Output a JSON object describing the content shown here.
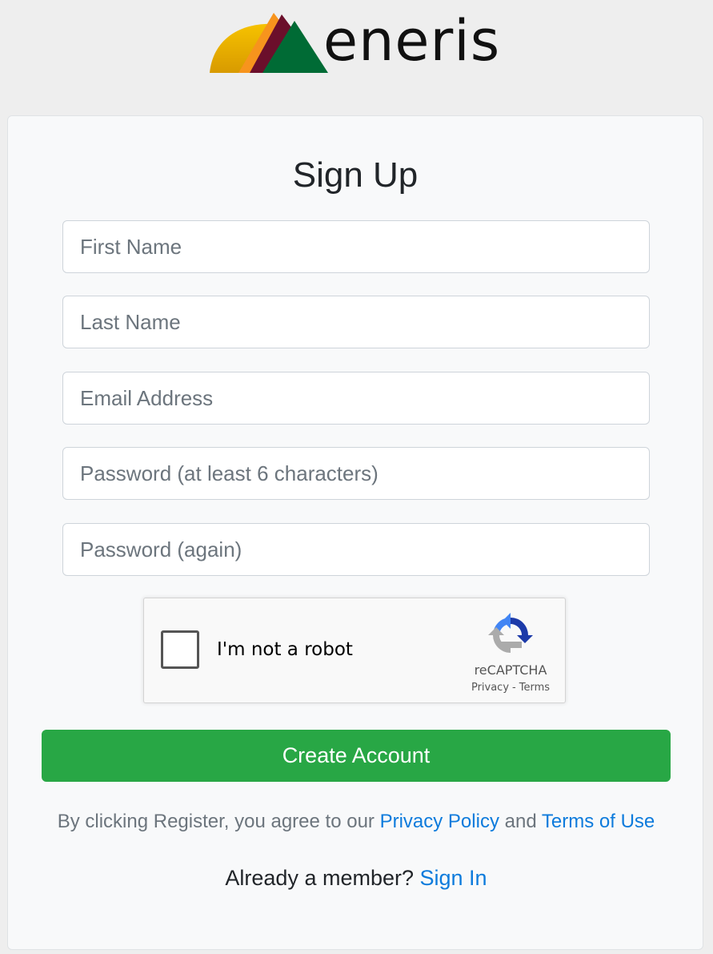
{
  "brand": {
    "logo_text": "eneris",
    "logo_icon": "mountain-sun-logo",
    "colors": {
      "sun": "#f2b705",
      "orange": "#f7941d",
      "maroon": "#6b0f2b",
      "green": "#006b35"
    }
  },
  "form": {
    "title": "Sign Up",
    "fields": {
      "first_name": {
        "placeholder": "First Name",
        "value": ""
      },
      "last_name": {
        "placeholder": "Last Name",
        "value": ""
      },
      "email": {
        "placeholder": "Email Address",
        "value": ""
      },
      "password": {
        "placeholder": "Password (at least 6 characters)",
        "value": ""
      },
      "password_again": {
        "placeholder": "Password (again)",
        "value": ""
      }
    },
    "captcha": {
      "label": "I'm not a robot",
      "checked": false,
      "brand": "reCAPTCHA",
      "privacy": "Privacy",
      "separator": "-",
      "terms": "Terms",
      "icon": "recaptcha-icon"
    },
    "submit_label": "Create Account",
    "submit_color": "#28a745",
    "agree": {
      "prefix": "By clicking Register, you agree to our ",
      "privacy_link": "Privacy Policy",
      "conjunction": " and ",
      "terms_link": "Terms of Use"
    },
    "member": {
      "prompt": "Already a member? ",
      "sign_in_link": "Sign In"
    }
  }
}
